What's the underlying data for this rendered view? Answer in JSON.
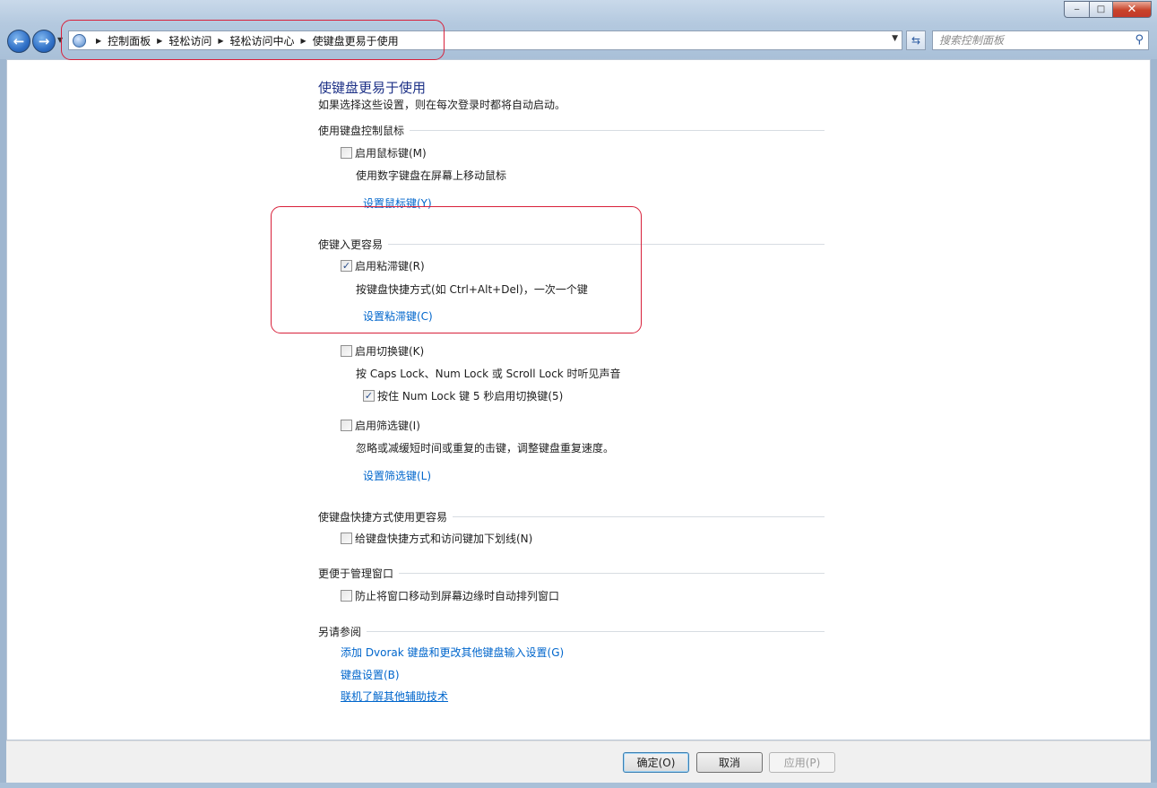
{
  "window": {
    "minimize_glyph": "‒",
    "maximize_glyph": "□",
    "close_glyph": "✕"
  },
  "nav": {
    "back_glyph": "←",
    "forward_glyph": "→"
  },
  "breadcrumb": [
    "控制面板",
    "轻松访问",
    "轻松访问中心",
    "使键盘更易于使用"
  ],
  "search": {
    "placeholder": "搜索控制面板"
  },
  "page": {
    "title": "使键盘更易于使用",
    "subtitle": "如果选择这些设置，则在每次登录时都将自动启动。"
  },
  "sections": {
    "mouse": {
      "heading": "使用键盘控制鼠标",
      "mousekeys": {
        "label": "启用鼠标键(M)",
        "checked": false
      },
      "mousekeys_desc": "使用数字键盘在屏幕上移动鼠标",
      "mousekeys_link": "设置鼠标键(Y)"
    },
    "typing": {
      "heading": "使键入更容易",
      "stickykeys": {
        "label": "启用粘滞键(R)",
        "checked": true
      },
      "stickykeys_desc": "按键盘快捷方式(如 Ctrl+Alt+Del)，一次一个键",
      "stickykeys_link": "设置粘滞键(C)",
      "togglekeys": {
        "label": "启用切换键(K)",
        "checked": false
      },
      "togglekeys_desc": "按 Caps Lock、Num Lock 或 Scroll Lock 时听见声音",
      "numlock_hold": {
        "label": "按住 Num Lock 键 5 秒启用切换键(5)",
        "checked": true
      },
      "filterkeys": {
        "label": "启用筛选键(I)",
        "checked": false
      },
      "filterkeys_desc": "忽略或减缓短时间或重复的击键，调整键盘重复速度。",
      "filterkeys_link": "设置筛选键(L)"
    },
    "shortcuts": {
      "heading": "使键盘快捷方式使用更容易",
      "underline": {
        "label": "给键盘快捷方式和访问键加下划线(N)",
        "checked": false
      }
    },
    "windows": {
      "heading": "更便于管理窗口",
      "prevent_arrange": {
        "label": "防止将窗口移动到屏幕边缘时自动排列窗口",
        "checked": false
      }
    },
    "see_also": {
      "heading": "另请参阅",
      "links": [
        "添加 Dvorak 键盘和更改其他键盘输入设置(G)",
        "键盘设置(B)",
        "联机了解其他辅助技术"
      ]
    }
  },
  "buttons": {
    "ok": "确定(O)",
    "cancel": "取消",
    "apply": "应用(P)"
  }
}
